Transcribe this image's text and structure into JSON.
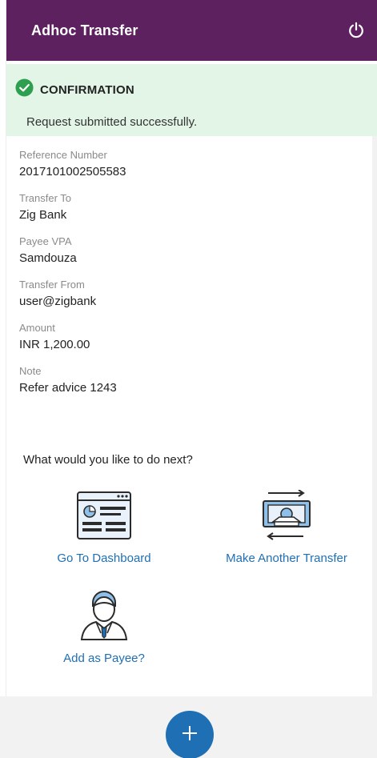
{
  "header": {
    "title": "Adhoc Transfer",
    "icon": "power-icon"
  },
  "confirmation": {
    "title": "CONFIRMATION",
    "message": "Request submitted successfully.",
    "icon": "check-circle-icon",
    "color": "#2e9e4f"
  },
  "details": [
    {
      "label": "Reference Number",
      "value": "2017101002505583"
    },
    {
      "label": "Transfer To",
      "value": "Zig Bank"
    },
    {
      "label": "Payee VPA",
      "value": "Samdouza"
    },
    {
      "label": "Transfer From",
      "value": "user@zigbank"
    },
    {
      "label": "Amount",
      "value": "INR 1,200.00"
    },
    {
      "label": "Note",
      "value": "Refer advice 1243"
    }
  ],
  "next": {
    "question": "What would you like to do next?",
    "actions": [
      {
        "label": "Go To Dashboard",
        "icon": "dashboard-icon"
      },
      {
        "label": "Make Another Transfer",
        "icon": "money-transfer-icon"
      },
      {
        "label": "Add as Payee?",
        "icon": "person-icon"
      }
    ]
  },
  "fab": {
    "icon": "plus-icon"
  },
  "colors": {
    "brand": "#5e2160",
    "accent": "#1f6fb5",
    "success_bg": "#e3f5e7"
  }
}
